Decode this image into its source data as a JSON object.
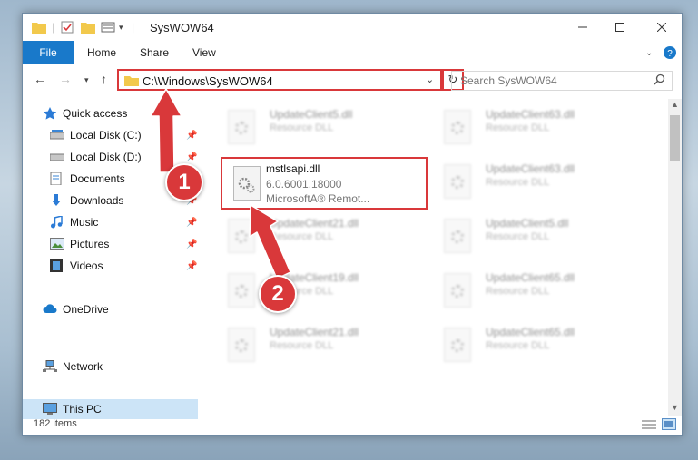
{
  "window": {
    "title": "SysWOW64"
  },
  "ribbon": {
    "file_tab": "File",
    "tabs": [
      "Home",
      "Share",
      "View"
    ]
  },
  "address": {
    "path": "C:\\Windows\\SysWOW64"
  },
  "search": {
    "placeholder": "Search SysWOW64"
  },
  "sidebar": {
    "items": [
      {
        "label": "Quick access",
        "icon": "star-icon",
        "pinned": false
      },
      {
        "label": "Local Disk (C:)",
        "icon": "drive-icon",
        "pinned": true
      },
      {
        "label": "Local Disk (D:)",
        "icon": "drive-icon",
        "pinned": true
      },
      {
        "label": "Documents",
        "icon": "documents-icon",
        "pinned": true
      },
      {
        "label": "Downloads",
        "icon": "download-icon",
        "pinned": true
      },
      {
        "label": "Music",
        "icon": "music-icon",
        "pinned": true
      },
      {
        "label": "Pictures",
        "icon": "pictures-icon",
        "pinned": true
      },
      {
        "label": "Videos",
        "icon": "videos-icon",
        "pinned": true
      },
      {
        "label": "OneDrive",
        "icon": "cloud-icon",
        "pinned": false
      },
      {
        "label": "This PC",
        "icon": "computer-icon",
        "pinned": false
      },
      {
        "label": "Network",
        "icon": "network-icon",
        "pinned": false
      }
    ]
  },
  "files": {
    "selected": {
      "name": "mstlsapi.dll",
      "version": "6.0.6001.18000",
      "description": "MicrosoftA® Remot..."
    },
    "blurred": [
      {
        "name": "UpdateClient5.dll",
        "type": "Resource DLL"
      },
      {
        "name": "UpdateClient63.dll",
        "type": "Resource DLL"
      },
      {
        "name": "UpdateClient63.dll",
        "type": "Resource DLL"
      },
      {
        "name": "UpdateClient21.dll",
        "type": "Resource DLL"
      },
      {
        "name": "UpdateClient5.dll",
        "type": "Resource DLL"
      },
      {
        "name": "UpdateClient19.dll",
        "type": "Resource DLL"
      },
      {
        "name": "UpdateClient65.dll",
        "type": "Resource DLL"
      },
      {
        "name": "UpdateClient21.dll",
        "type": "Resource DLL"
      },
      {
        "name": "UpdateClient65.dll",
        "type": "Resource DLL"
      }
    ]
  },
  "status": {
    "item_count": "182 items"
  },
  "annotations": {
    "step1": "1",
    "step2": "2"
  },
  "colors": {
    "accent": "#1979ca",
    "highlight": "#d9383a",
    "selection": "#cce4f7"
  }
}
